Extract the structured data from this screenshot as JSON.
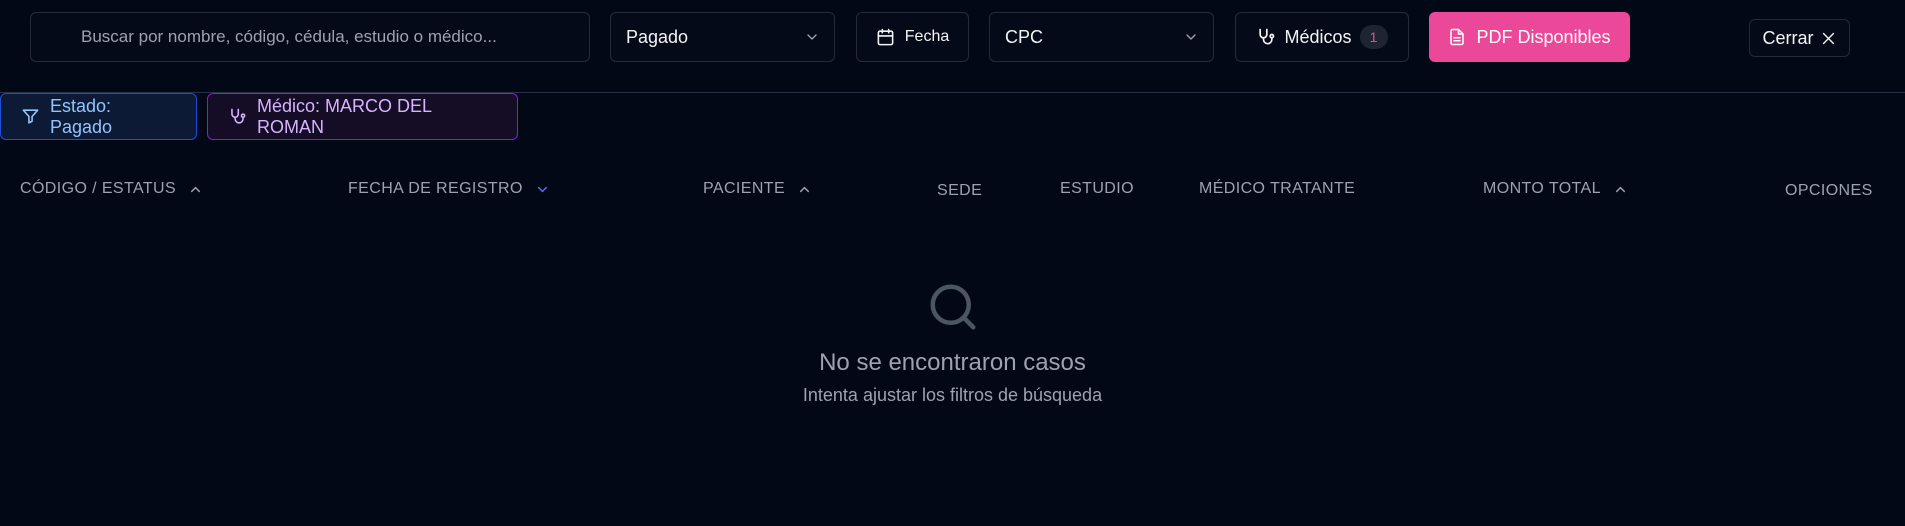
{
  "toolbar": {
    "search_placeholder": "Buscar por nombre, código, cédula, estudio o médico...",
    "status_value": "Pagado",
    "date_label": "Fecha",
    "branch_value": "CPC",
    "doctors_label": "Médicos",
    "doctors_count": "1",
    "pdf_label": "PDF Disponibles",
    "close_label": "Cerrar"
  },
  "chips": {
    "estado": "Estado: Pagado",
    "medico": "Médico: MARCO DEL ROMAN"
  },
  "table": {
    "headers": [
      "CÓDIGO / ESTATUS",
      "FECHA DE REGISTRO",
      "PACIENTE",
      "SEDE",
      "ESTUDIO",
      "MÉDICO TRATANTE",
      "MONTO TOTAL",
      "OPCIONES"
    ]
  },
  "empty_state": {
    "title": "No se encontraron casos",
    "subtitle": "Intenta ajustar los filtros de búsqueda"
  },
  "colors": {
    "background": "#030816",
    "accent_pink": "#ec4899",
    "chip_blue": "#93c5fd",
    "chip_purple": "#d8b4fe",
    "sort_active": "#6366f1"
  },
  "icons": {
    "date": "calendar-icon",
    "doctors": "stethoscope-icon",
    "pdf": "document-icon",
    "close": "close-icon",
    "filter": "filter-icon",
    "empty": "search-icon"
  }
}
